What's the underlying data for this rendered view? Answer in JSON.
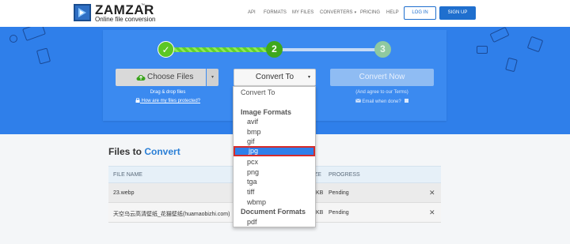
{
  "brand": {
    "name": "ZAMZAR",
    "tm": "™",
    "tagline": "Online file conversion"
  },
  "nav": {
    "items": [
      "API",
      "FORMATS",
      "MY FILES",
      "CONVERTERS",
      "PRICING",
      "HELP"
    ],
    "converters_caret": "▾",
    "login": "LOG IN",
    "signup": "SIGN UP"
  },
  "steps": {
    "one": "✓",
    "two": "2",
    "three": "3",
    "current": 2
  },
  "upload": {
    "choose_files": "Choose Files",
    "caret": "▾",
    "drag_drop": "Drag & drop files",
    "protected_link": "How are my files protected?"
  },
  "convert": {
    "label": "Convert To",
    "caret": "▾",
    "convert_now": "Convert Now",
    "agree_text": "(And agree to our Terms)",
    "email_text": "Email when done?"
  },
  "dropdown": {
    "first": "Convert To",
    "image_header": "Image Formats",
    "image_options": [
      "avif",
      "bmp",
      "gif",
      "jpg",
      "pcx",
      "png",
      "tga",
      "tiff",
      "wbmp"
    ],
    "selected": "jpg",
    "document_header": "Document Formats",
    "document_options": [
      "pdf"
    ]
  },
  "files": {
    "title_plain": "Files to",
    "title_accent": "Convert",
    "columns": {
      "file_name": "FILE NAME",
      "size": "ZE",
      "progress": "PROGRESS"
    },
    "rows": [
      {
        "name": "23.webp",
        "size": "KB",
        "progress": "Pending",
        "remove": "✕"
      },
      {
        "name": "天空乌云高清壁纸_花猫壁纸(huamaobizhi.com)",
        "size": "KB",
        "progress": "Pending",
        "remove": "✕"
      }
    ]
  },
  "colors": {
    "hero_blue": "#2f7fea",
    "panel_blue": "#3b8af0",
    "step_green": "#5cc725",
    "selection_outline": "#d62b2b",
    "accent": "#2a7fd6"
  },
  "icons": {
    "logo": "zamzar-logo-icon",
    "upload": "cloud-upload-icon",
    "lock": "lock-icon",
    "email": "envelope-icon",
    "checkbox": "checkbox-icon"
  }
}
